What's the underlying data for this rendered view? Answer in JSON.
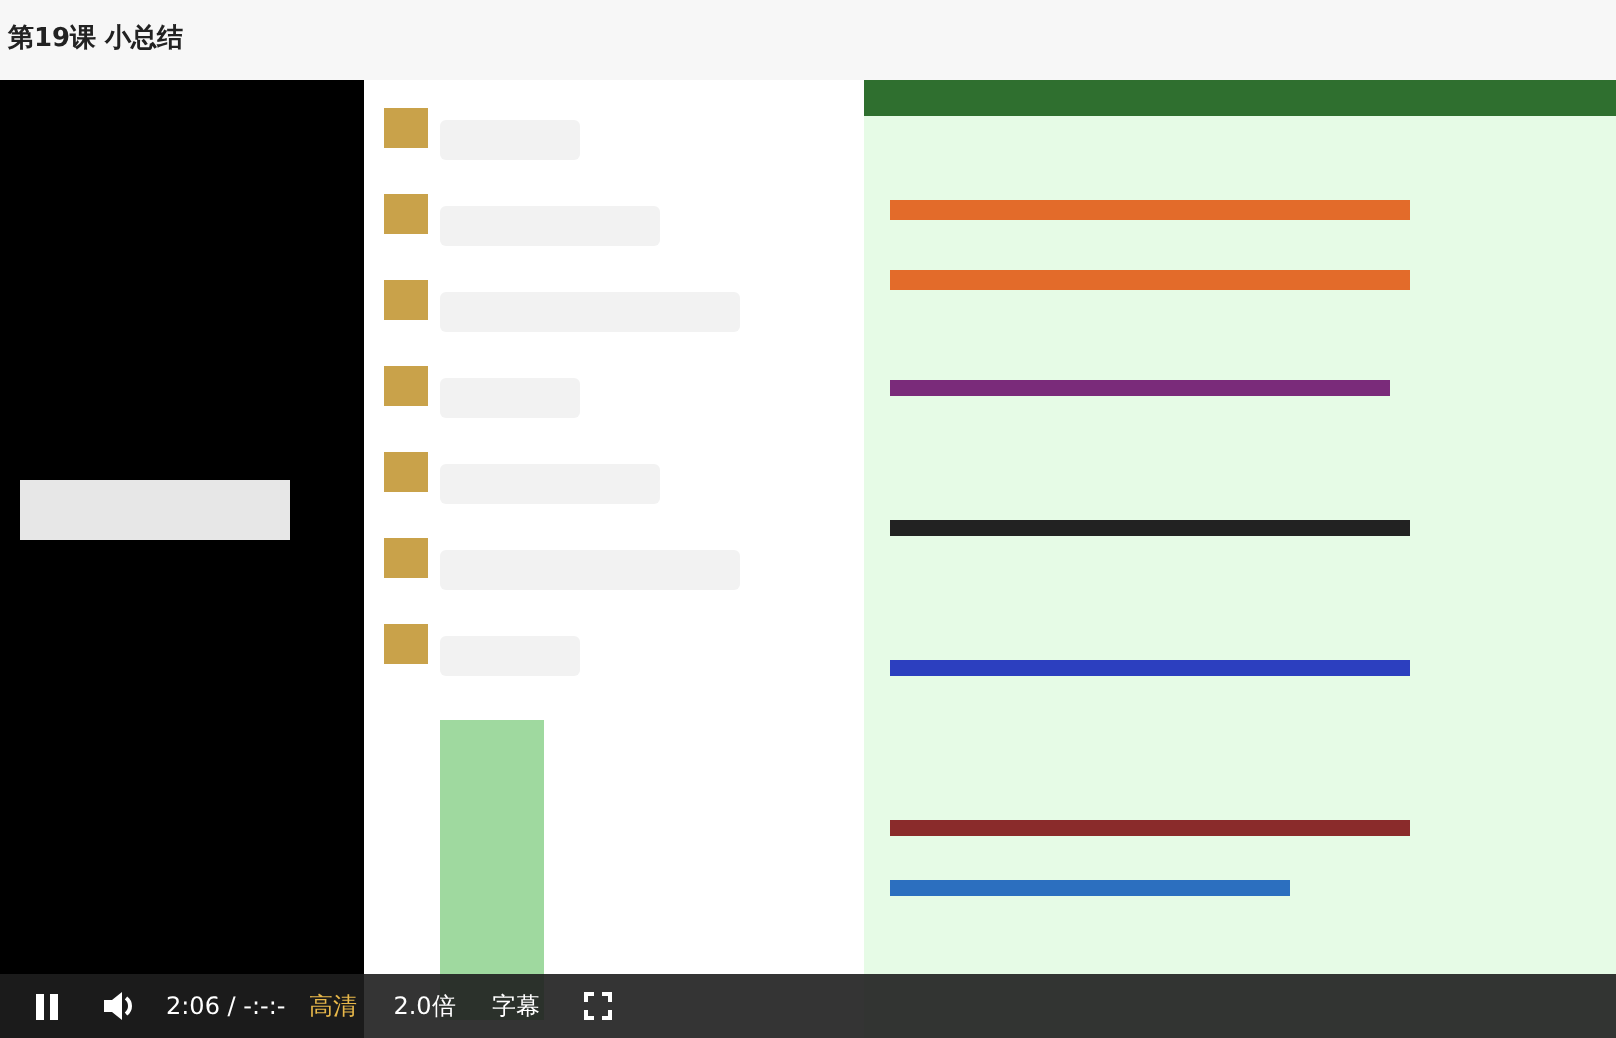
{
  "title": "第19课 小总结",
  "player": {
    "controls": {
      "time": "2:06 / -:-:-",
      "quality": "高清",
      "speed": "2.0倍",
      "subtitles": "字幕"
    }
  }
}
